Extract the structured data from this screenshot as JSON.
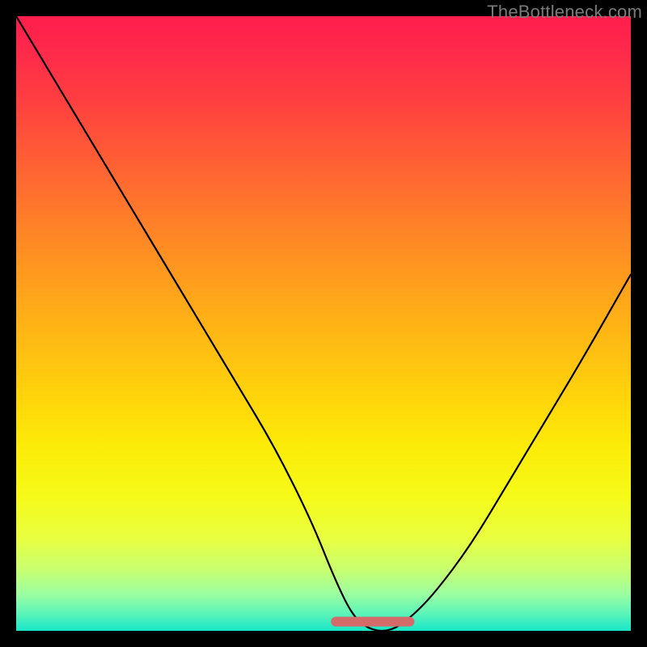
{
  "watermark": "TheBottleneck.com",
  "colors": {
    "frame": "#000000",
    "curve": "#000000",
    "flat_segment": "#d46a6a",
    "gradient_top": "#ff1e4d",
    "gradient_bottom": "#18e6c8"
  },
  "chart_data": {
    "type": "line",
    "title": "",
    "xlabel": "",
    "ylabel": "",
    "xlim": [
      0,
      100
    ],
    "ylim": [
      0,
      100
    ],
    "notes": "Bottleneck-style V curve. y is plotted with 0 at bottom (good/green) and 100 at top (bad/red). Background is a vertical rainbow gradient from red (top) to green (bottom). The flat trough is highlighted with a thick salmon segment.",
    "series": [
      {
        "name": "bottleneck-curve",
        "x": [
          0,
          6,
          12,
          18,
          24,
          30,
          36,
          42,
          48,
          52,
          55,
          58,
          61,
          64,
          68,
          74,
          80,
          86,
          92,
          100
        ],
        "y": [
          100,
          90,
          80,
          70,
          60,
          50,
          40,
          30,
          18,
          8,
          2,
          0,
          0,
          2,
          6,
          14,
          24,
          34,
          44,
          58
        ]
      }
    ],
    "flat_region": {
      "x_start": 52,
      "x_end": 64,
      "y": 1.5
    }
  }
}
